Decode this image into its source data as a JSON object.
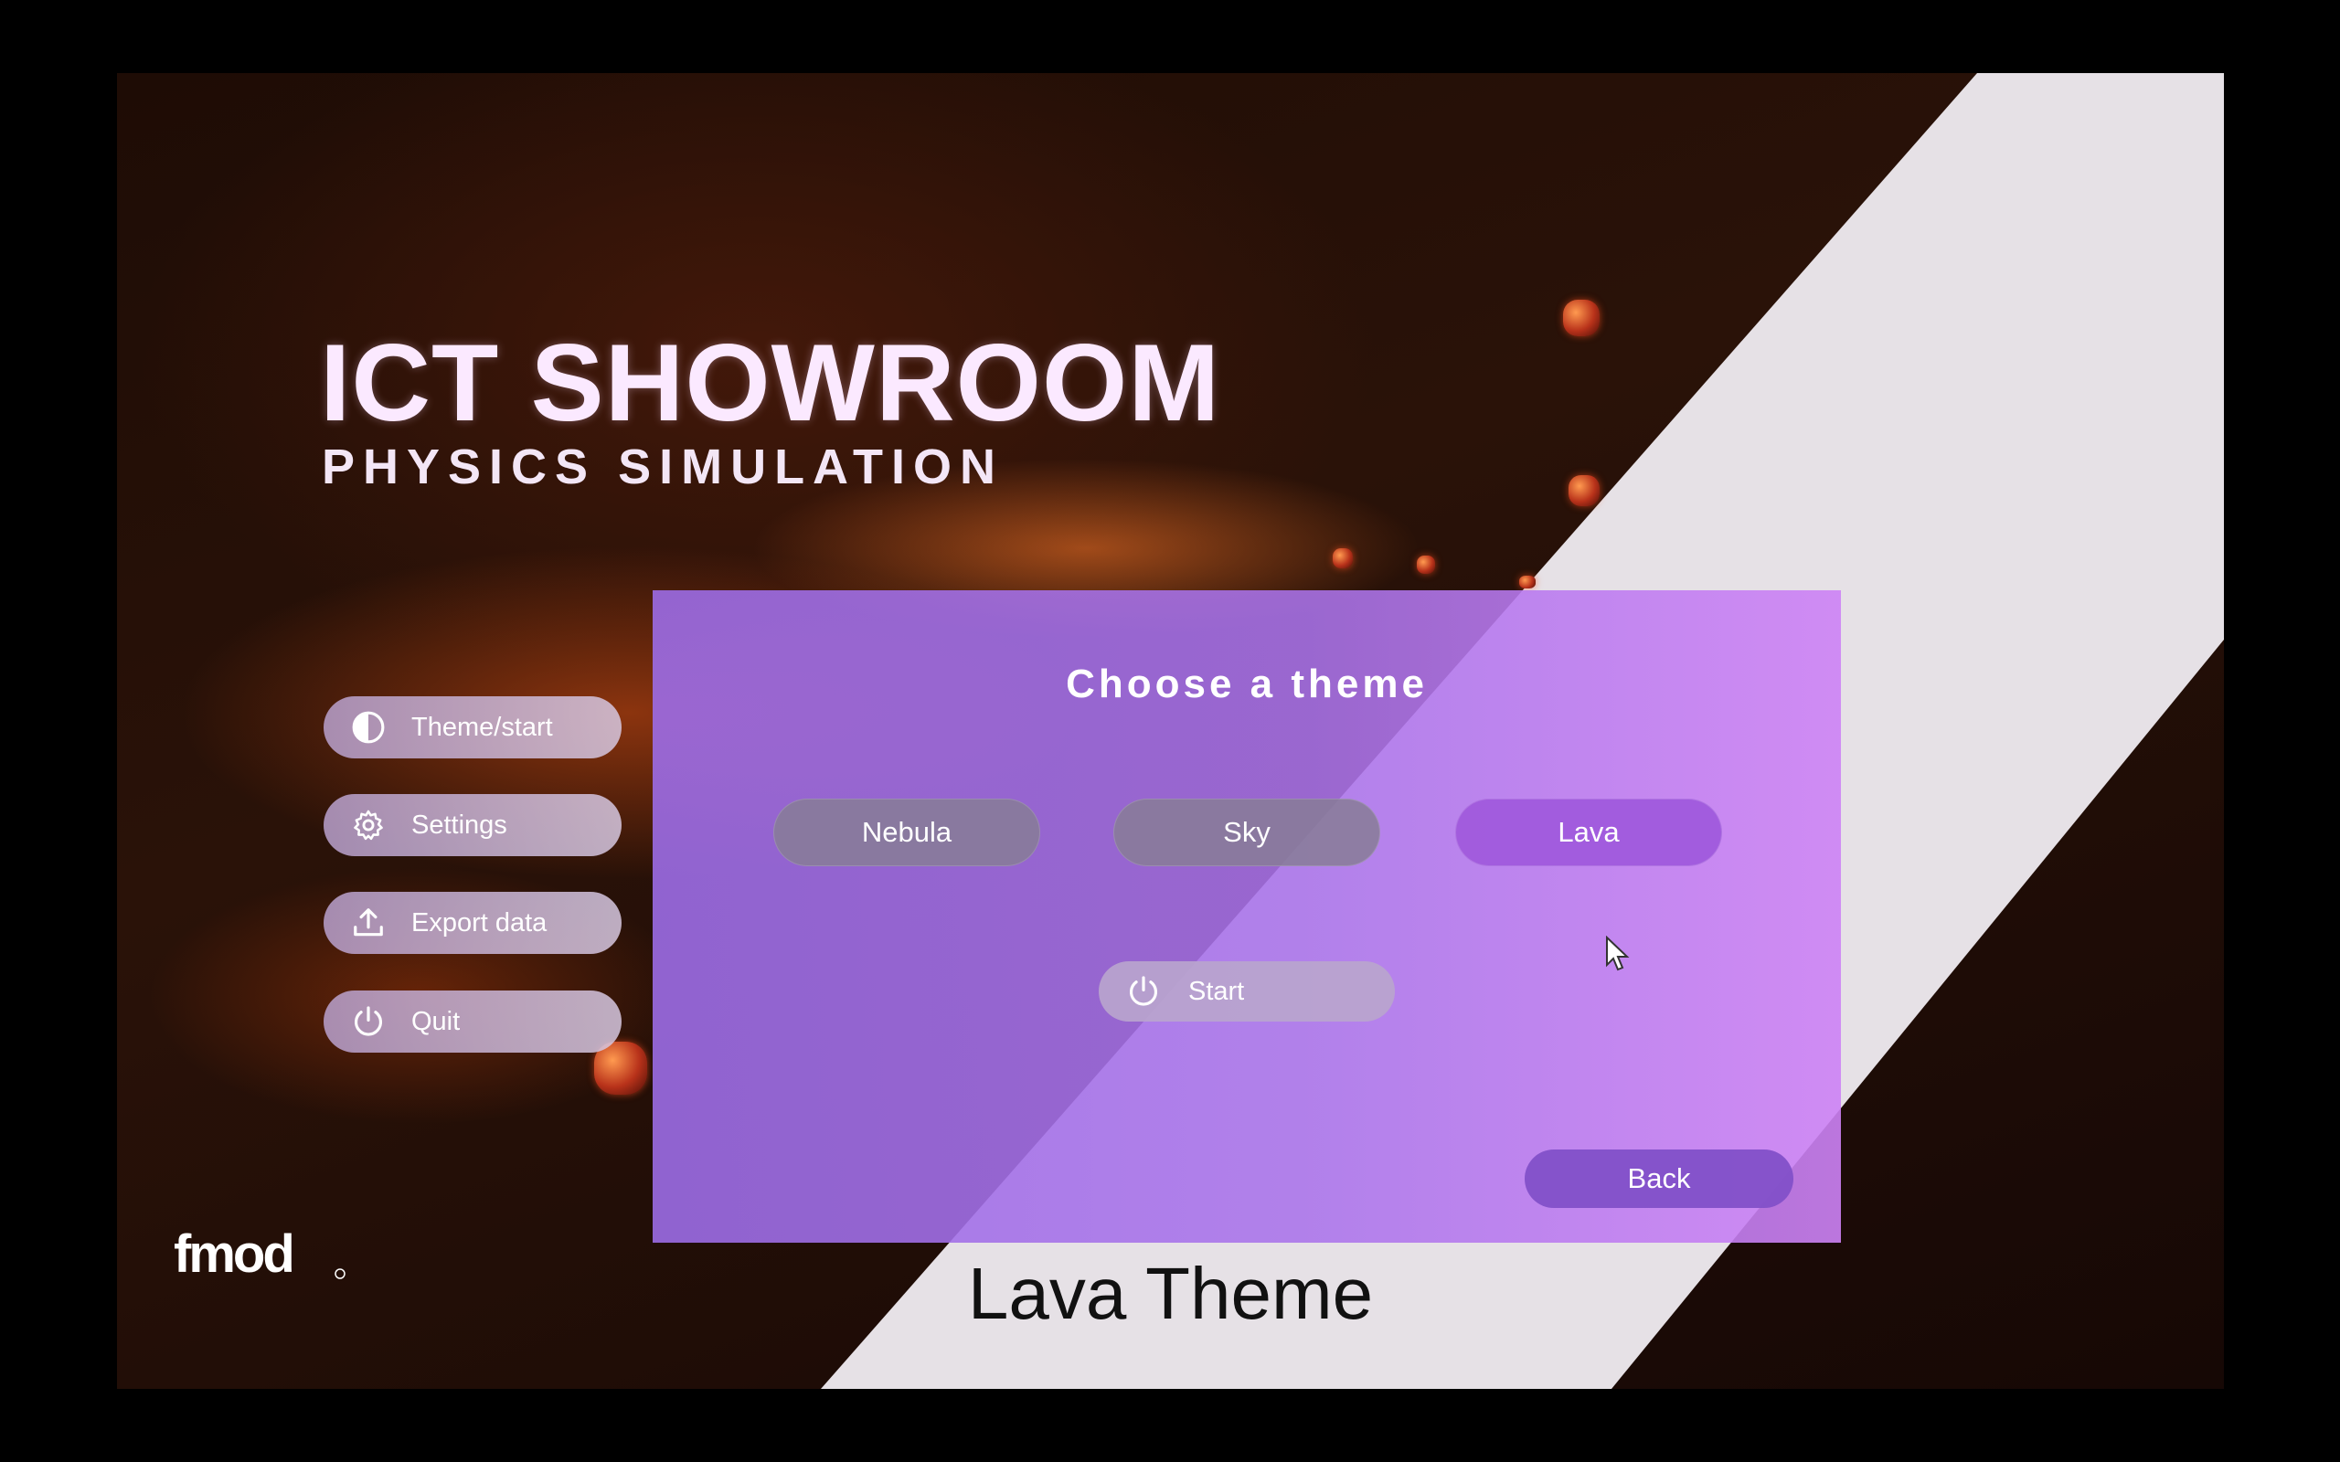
{
  "app": {
    "title": "ICT SHOWROOM",
    "subtitle": "PHYSICS SIMULATION",
    "logo": "fmod",
    "caption": "Lava Theme"
  },
  "menu": {
    "items": [
      {
        "label": "Theme/start",
        "icon": "contrast-icon"
      },
      {
        "label": "Settings",
        "icon": "gear-icon"
      },
      {
        "label": "Export data",
        "icon": "upload-icon"
      },
      {
        "label": "Quit",
        "icon": "power-icon"
      }
    ]
  },
  "theme_panel": {
    "title": "Choose a theme",
    "options": [
      {
        "label": "Nebula",
        "selected": false
      },
      {
        "label": "Sky",
        "selected": false
      },
      {
        "label": "Lava",
        "selected": true
      }
    ],
    "start_label": "Start",
    "back_label": "Back"
  },
  "colors": {
    "panel": "#a874e8",
    "lava_selected": "#a05adc",
    "background": "#1e0c05",
    "stripe": "#e6e1e6"
  }
}
